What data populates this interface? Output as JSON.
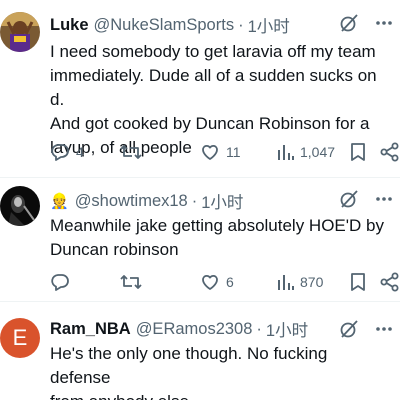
{
  "tweets": [
    {
      "name": "Luke",
      "handle": "@NukeSlamSports",
      "time": "1小时",
      "text_lines": [
        "I need somebody to get laravia off my team",
        "immediately. Dude all of a sudden sucks on d.",
        "And got cooked by Duncan Robinson for a",
        "layup, of all people"
      ],
      "replies": "4",
      "reposts": "",
      "likes": "11",
      "views": "1,047"
    },
    {
      "emoji": "👷",
      "handle": "@showtimex18",
      "time": "1小时",
      "text_lines": [
        "Meanwhile jake getting absolutely HOE'D by",
        "Duncan robinson"
      ],
      "replies": "",
      "reposts": "",
      "likes": "6",
      "views": "870"
    },
    {
      "avatar_letter": "E",
      "name": "Ram_NBA",
      "handle": "@ERamos2308",
      "time": "1小时",
      "text_lines": [
        "He's the only one though. No fucking defense",
        "from anybody else"
      ]
    }
  ],
  "colors": {
    "text": "#0f1419",
    "secondary": "#536471",
    "divider": "#eff3f4",
    "avatar_e_bg": "#d9532c"
  },
  "icons": [
    "reply-icon",
    "repost-icon",
    "like-icon",
    "views-icon",
    "bookmark-icon",
    "share-icon",
    "grok-icon",
    "more-icon"
  ]
}
